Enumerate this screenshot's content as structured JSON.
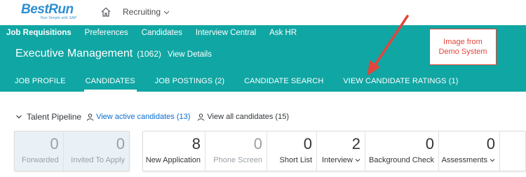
{
  "brand": {
    "name": "BestRun",
    "tagline": "Run Simple with SAP"
  },
  "shell": {
    "module_label": "Recruiting"
  },
  "subnav": [
    {
      "label": "Job Requisitions",
      "active": true
    },
    {
      "label": "Preferences"
    },
    {
      "label": "Candidates"
    },
    {
      "label": "Interview Central"
    },
    {
      "label": "Ask HR"
    }
  ],
  "header": {
    "title": "Executive Management",
    "count": "(1062)",
    "view_details": "View Details"
  },
  "tabs": [
    {
      "label": "JOB PROFILE"
    },
    {
      "label": "CANDIDATES",
      "active": true
    },
    {
      "label": "JOB POSTINGS (2)"
    },
    {
      "label": "CANDIDATE SEARCH"
    },
    {
      "label": "VIEW CANDIDATE RATINGS (1)"
    }
  ],
  "note": {
    "text": "Image from Demo System"
  },
  "pipeline": {
    "title": "Talent Pipeline",
    "active_link": "View active candidates (13)",
    "all_link": "View all candidates (15)",
    "left_group": [
      {
        "count": "0",
        "label": "Forwarded"
      },
      {
        "count": "0",
        "label": "Invited To Apply"
      }
    ],
    "stages": [
      {
        "count": "8",
        "label": "New Application"
      },
      {
        "count": "0",
        "label": "Phone Screen"
      },
      {
        "count": "0",
        "label": "Short List"
      },
      {
        "count": "2",
        "label": "Interview"
      },
      {
        "count": "0",
        "label": "Background Check"
      },
      {
        "count": "0",
        "label": "Assessments"
      }
    ]
  },
  "colors": {
    "teal": "#10a6a3",
    "link_blue": "#0a6ed1",
    "annotation_red": "#e3453a"
  }
}
